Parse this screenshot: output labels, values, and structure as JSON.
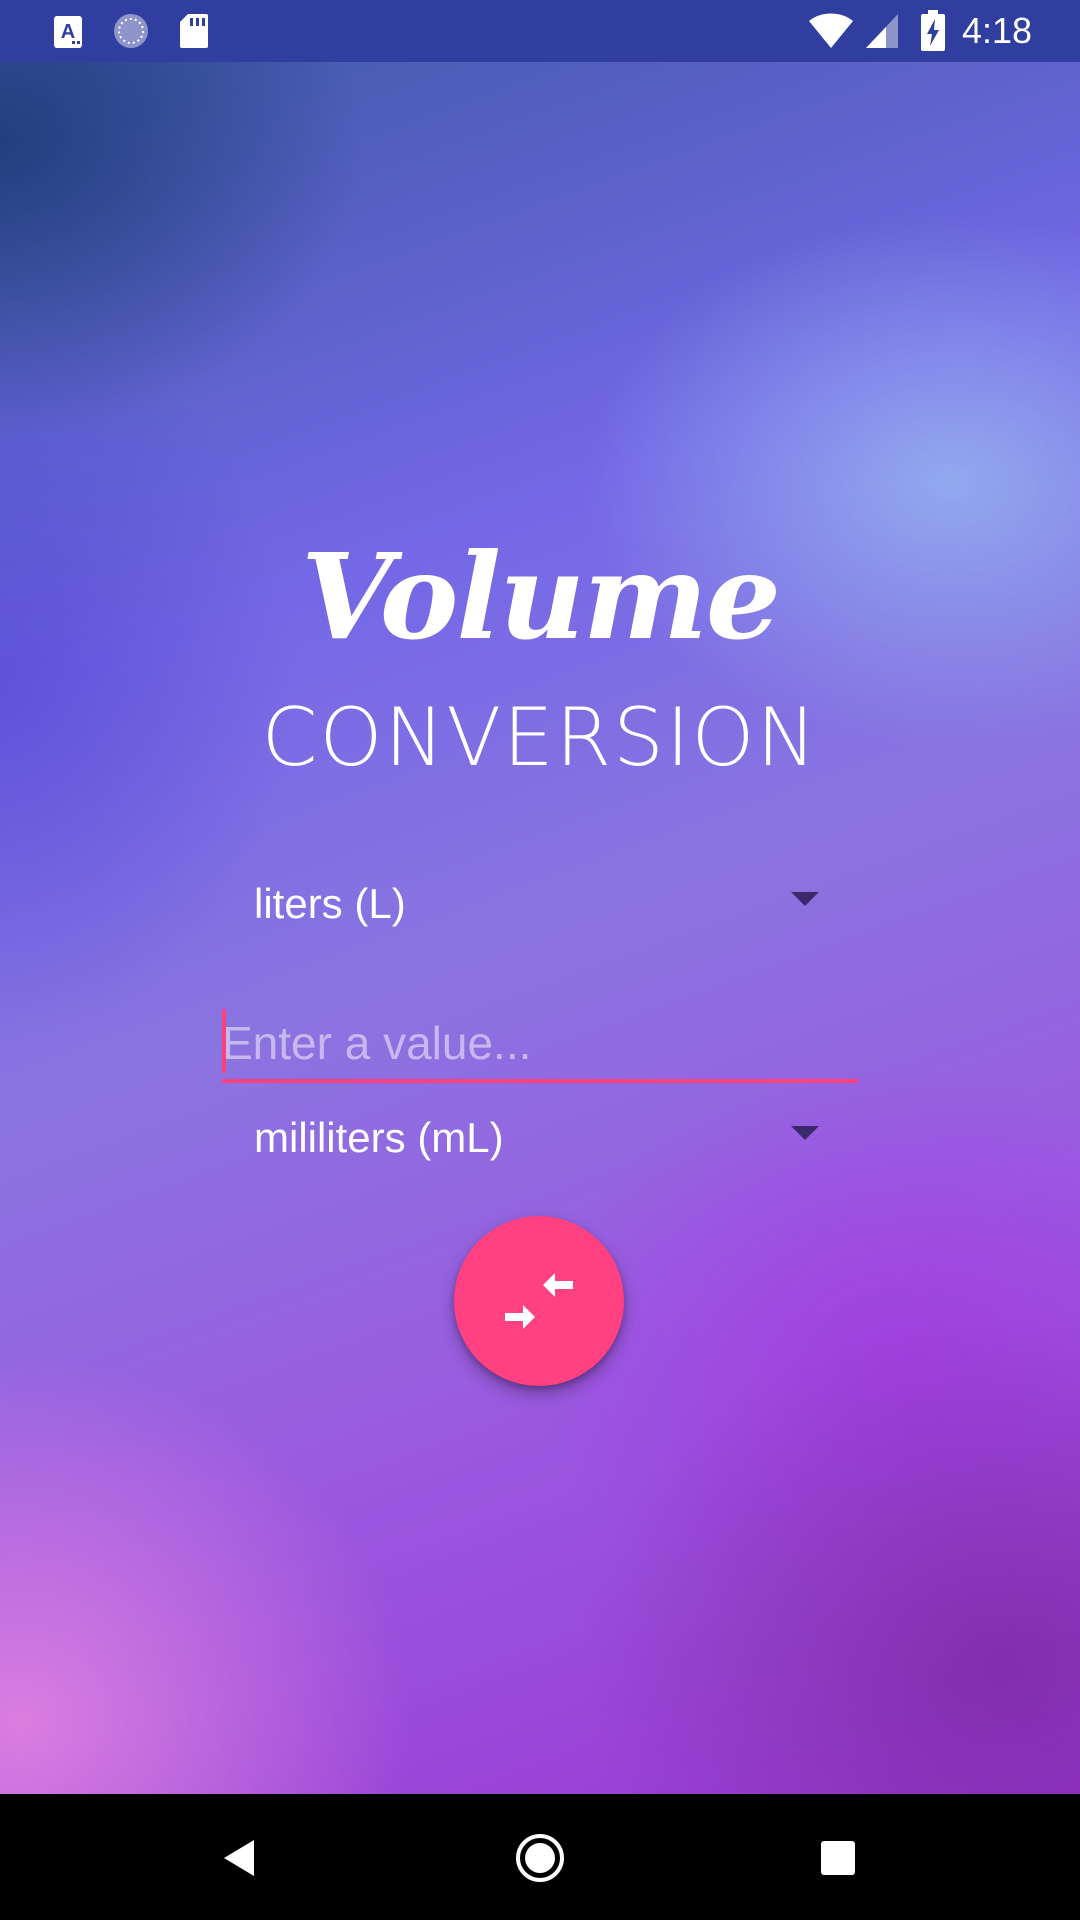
{
  "status_bar": {
    "time": "4:18",
    "icons": [
      "a-notification-icon",
      "sync-icon",
      "sd-card-icon",
      "wifi-icon",
      "signal-icon",
      "battery-charging-icon"
    ]
  },
  "main": {
    "title": "Volume",
    "subtitle": "CONVERSION",
    "from_unit": {
      "selected": "liters (L)"
    },
    "value_input": {
      "value": "",
      "placeholder": "Enter a value..."
    },
    "to_unit": {
      "selected": "mililiters (mL)"
    },
    "convert_button": {
      "icon": "swap-arrows-icon"
    }
  },
  "nav_bar": {
    "icons": [
      "back-icon",
      "home-icon",
      "recents-icon"
    ]
  },
  "colors": {
    "status_bar": "#303f9f",
    "accent": "#ff4081",
    "text": "#ffffff"
  }
}
